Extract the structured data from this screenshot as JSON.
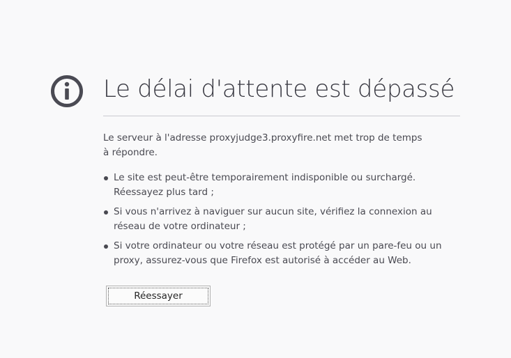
{
  "error": {
    "icon": "info-icon",
    "title": "Le délai d'attente est dépassé",
    "description": "Le serveur à l'adresse proxyjudge3.proxyfire.net met trop de temps à répondre.",
    "suggestions": [
      "Le site est peut-être temporairement indisponible ou surchargé. Réessayez plus tard ;",
      "Si vous n'arrivez à naviguer sur aucun site, vérifiez la connexion au réseau de votre ordinateur ;",
      "Si votre ordinateur ou votre réseau est protégé par un pare-feu ou un proxy, assurez-vous que Firefox est autorisé à accéder au Web."
    ],
    "retry_label": "Réessayer"
  },
  "colors": {
    "background": "#f9f9fa",
    "icon": "#4a4a53",
    "title": "#383841",
    "text": "#494951",
    "divider": "#c9c9cf"
  }
}
